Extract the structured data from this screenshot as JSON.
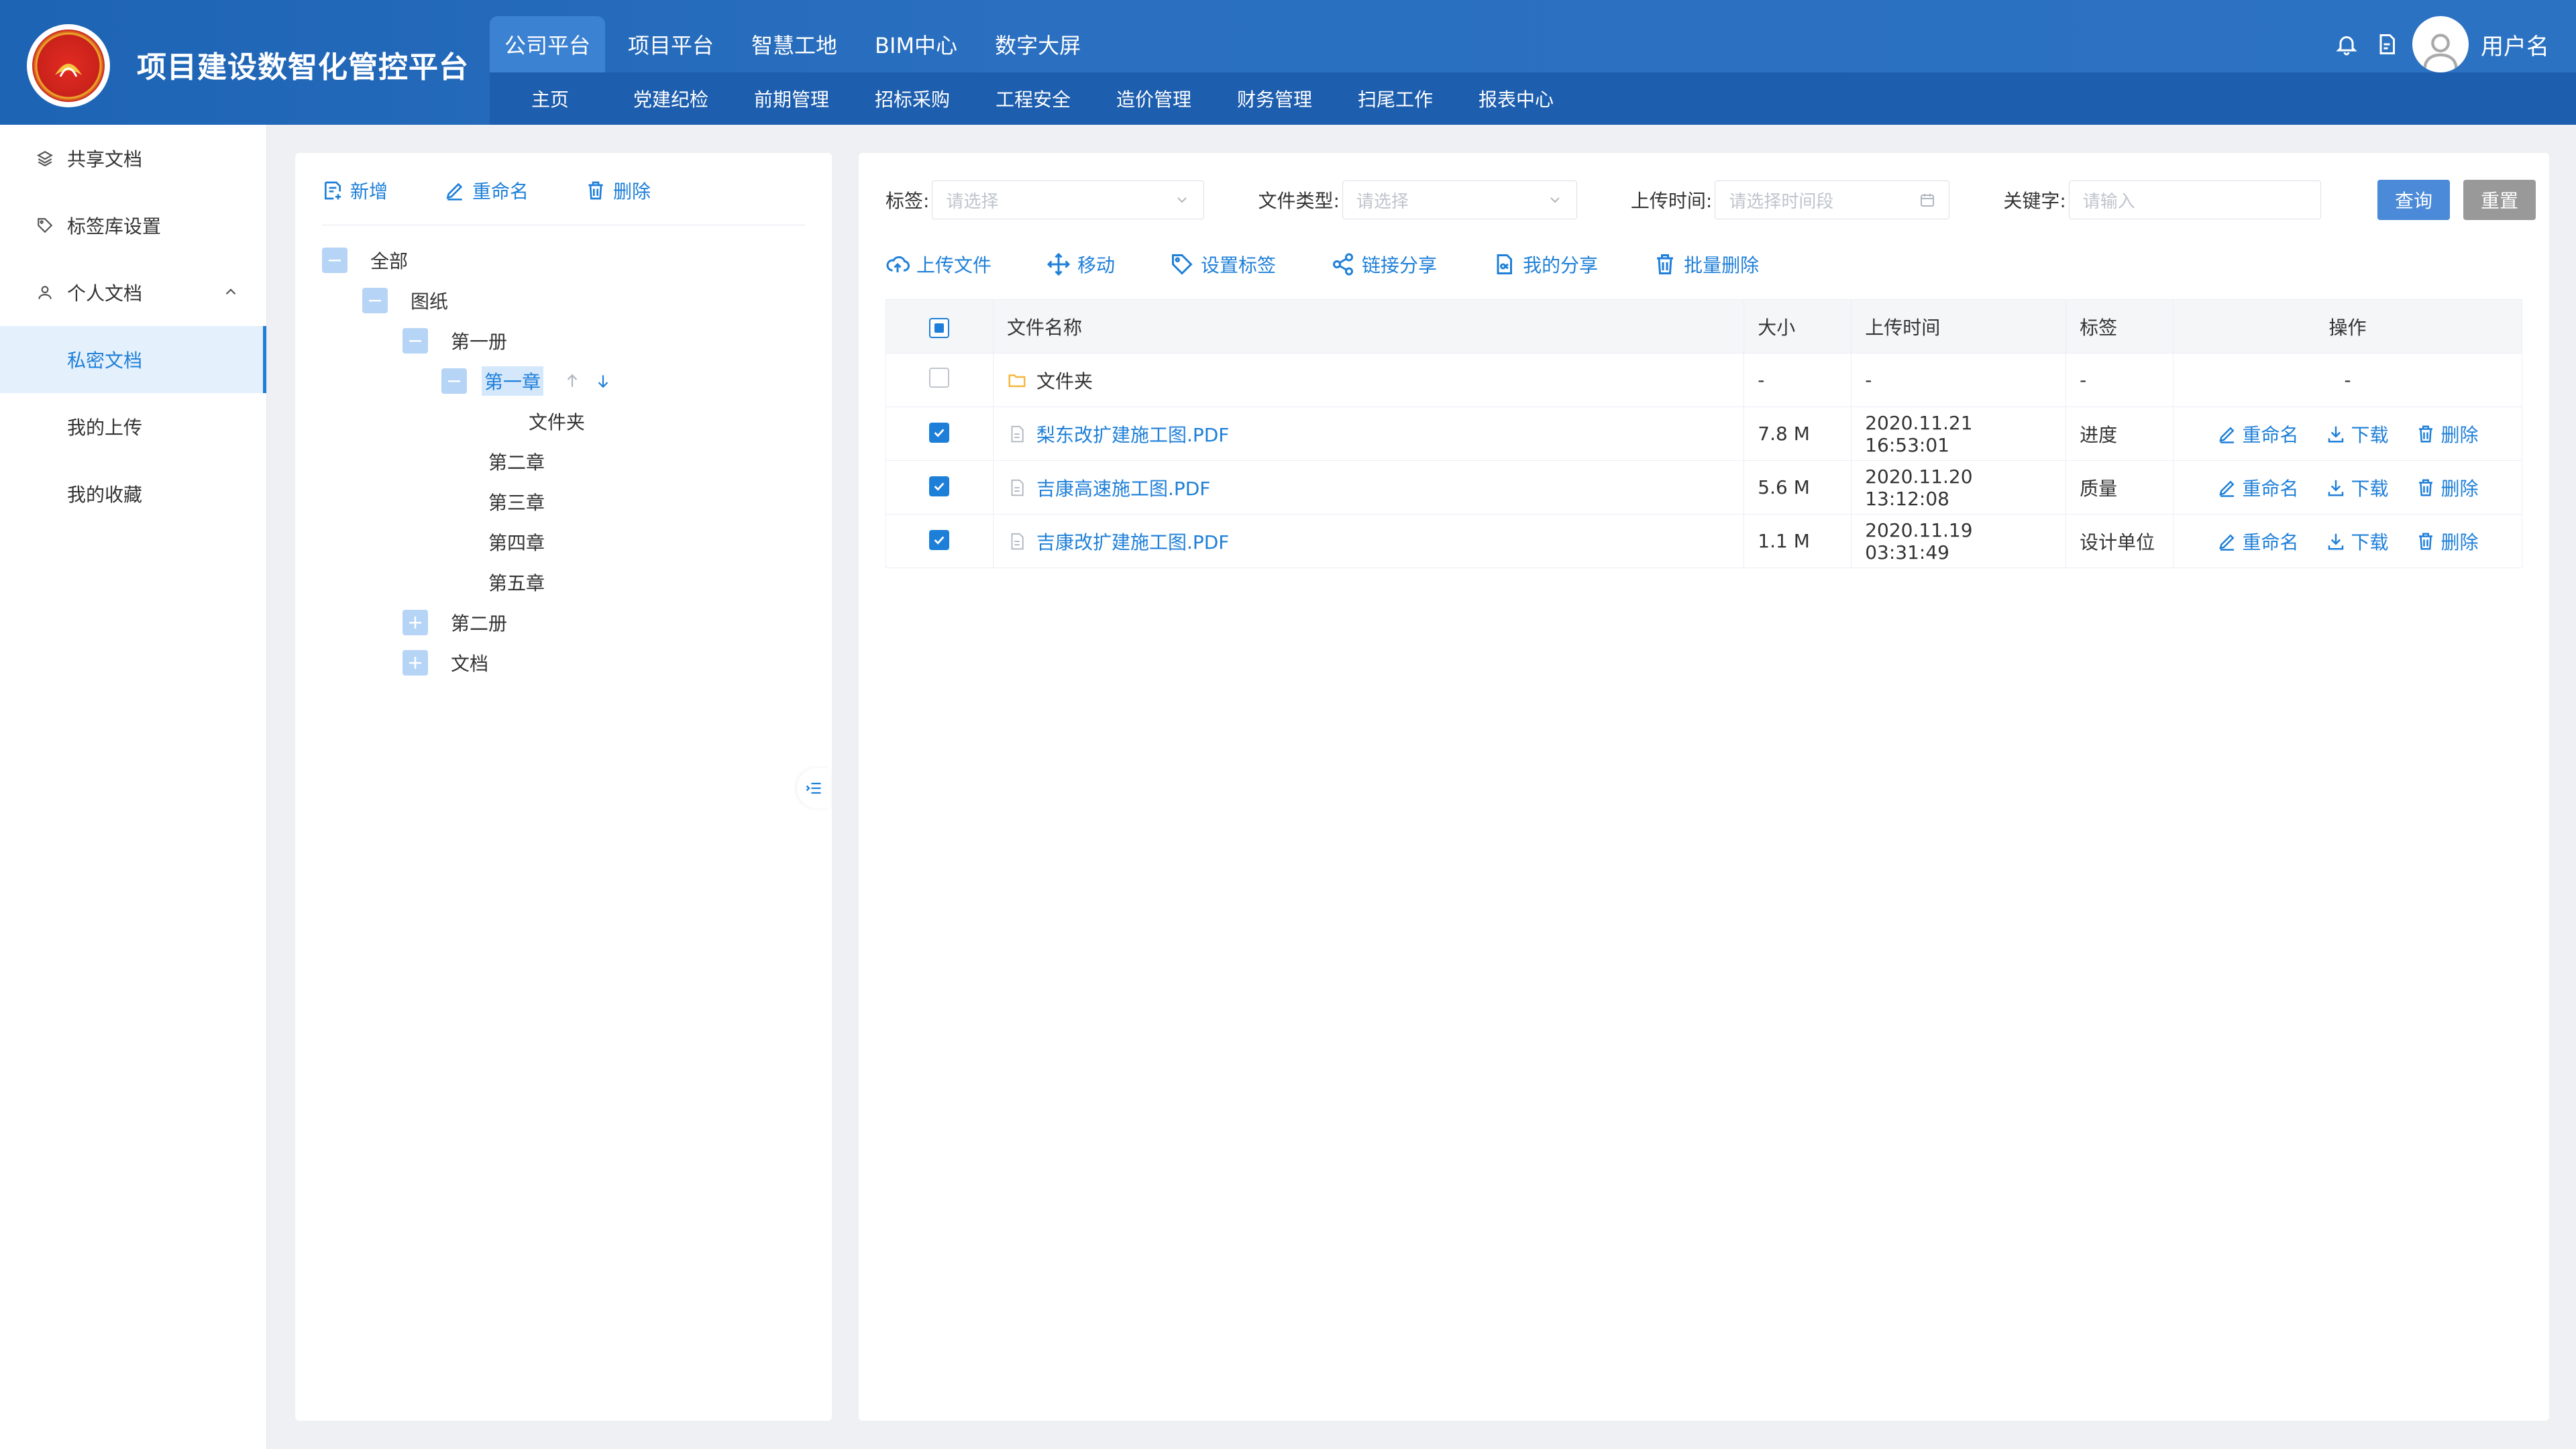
{
  "app": {
    "title": "项目建设数智化管控平台",
    "username": "用户名"
  },
  "top_tabs": [
    "公司平台",
    "项目平台",
    "智慧工地",
    "BIM中心",
    "数字大屏"
  ],
  "sub_nav": [
    "主页",
    "党建纪检",
    "前期管理",
    "招标采购",
    "工程安全",
    "造价管理",
    "财务管理",
    "扫尾工作",
    "报表中心"
  ],
  "sidebar": {
    "items": [
      {
        "label": "共享文档",
        "icon": "layers-icon"
      },
      {
        "label": "标签库设置",
        "icon": "tag-icon"
      },
      {
        "label": "个人文档",
        "icon": "user-icon"
      },
      {
        "label": "私密文档"
      },
      {
        "label": "我的上传"
      },
      {
        "label": "我的收藏"
      }
    ]
  },
  "tree": {
    "toolbar": {
      "add": "新增",
      "rename": "重命名",
      "delete": "删除"
    },
    "nodes": {
      "all": "全部",
      "drawings": "图纸",
      "vol1": "第一册",
      "ch1": "第一章",
      "folder": "文件夹",
      "ch2": "第二章",
      "ch3": "第三章",
      "ch4": "第四章",
      "ch5": "第五章",
      "vol2": "第二册",
      "docs": "文档"
    }
  },
  "filters": {
    "tag_label": "标签:",
    "tag_placeholder": "请选择",
    "type_label": "文件类型:",
    "type_placeholder": "请选择",
    "time_label": "上传时间:",
    "time_placeholder": "请选择时间段",
    "keyword_label": "关键字:",
    "keyword_placeholder": "请输入",
    "query": "查询",
    "reset": "重置"
  },
  "actions": {
    "upload": "上传文件",
    "move": "移动",
    "set_tag": "设置标签",
    "link_share": "链接分享",
    "my_share": "我的分享",
    "batch_delete": "批量删除"
  },
  "table": {
    "headers": {
      "name": "文件名称",
      "size": "大小",
      "time": "上传时间",
      "tag": "标签",
      "ops": "操作"
    },
    "rows": [
      {
        "name": "文件夹",
        "size": "-",
        "time": "-",
        "tag": "-",
        "ops": "-"
      },
      {
        "name": "梨东改扩建施工图.PDF",
        "size": "7.8 M",
        "time": "2020.11.21 16:53:01",
        "tag": "进度"
      },
      {
        "name": "吉康高速施工图.PDF",
        "size": "5.6 M",
        "time": "2020.11.20 13:12:08",
        "tag": "质量"
      },
      {
        "name": "吉康改扩建施工图.PDF",
        "size": "1.1 M",
        "time": "2020.11.19 03:31:49",
        "tag": "设计单位"
      }
    ],
    "op_labels": {
      "rename": "重命名",
      "download": "下载",
      "delete": "删除"
    }
  },
  "colors": {
    "header": "#1e64b4",
    "accent": "#1e7fd8",
    "tree_box": "#b6d4f6"
  }
}
